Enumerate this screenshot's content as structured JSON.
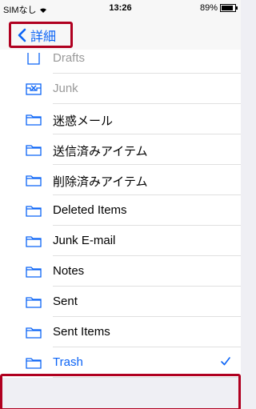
{
  "status_bar": {
    "carrier": "SIMなし",
    "time": "13:26",
    "battery_percent": "89%",
    "battery_level": 0.89
  },
  "nav": {
    "back_label": "詳細"
  },
  "folders": [
    {
      "label": "Drafts",
      "icon": "drafts-folder-icon"
    },
    {
      "label": "Junk",
      "icon": "junk-tray-icon"
    },
    {
      "label": "迷惑メール",
      "icon": "folder-icon"
    },
    {
      "label": "送信済みアイテム",
      "icon": "folder-icon"
    },
    {
      "label": "削除済みアイテム",
      "icon": "folder-icon"
    },
    {
      "label": "Deleted Items",
      "icon": "folder-icon"
    },
    {
      "label": "Junk E-mail",
      "icon": "folder-icon"
    },
    {
      "label": "Notes",
      "icon": "folder-icon"
    },
    {
      "label": "Sent",
      "icon": "folder-icon"
    },
    {
      "label": "Sent Items",
      "icon": "folder-icon"
    },
    {
      "label": "Trash",
      "icon": "folder-icon",
      "selected": true
    }
  ],
  "colors": {
    "accent": "#0a63f6",
    "highlight": "#b00020",
    "background": "#efeff4"
  }
}
